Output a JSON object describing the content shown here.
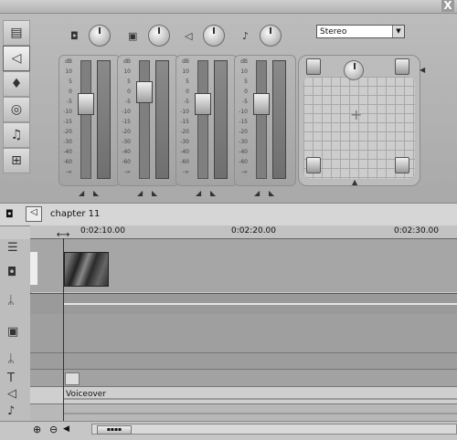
{
  "window": {
    "close_label": "X"
  },
  "mixer": {
    "tools": [
      {
        "icon": "video-toolbox-icon"
      },
      {
        "icon": "audio-toolbox-icon"
      },
      {
        "icon": "voiceover-icon"
      },
      {
        "icon": "disc-icon"
      },
      {
        "icon": "music-note-icon"
      },
      {
        "icon": "plug-icon"
      }
    ],
    "channels": [
      {
        "icon": "video-camera-icon"
      },
      {
        "icon": "clip-icon"
      },
      {
        "icon": "speaker-icon"
      },
      {
        "icon": "music-icon"
      }
    ],
    "output_mode": "Stereo",
    "db_scale": [
      "dB",
      "10",
      "5",
      "0",
      "-5",
      "-10",
      "-15",
      "-20",
      "-30",
      "-40",
      "-60",
      "-∞"
    ],
    "fader_levels": [
      0.34,
      0.22,
      0.34,
      0.34
    ]
  },
  "timeline": {
    "chapter": "chapter 11",
    "ruler_ticks": [
      "0:02:10.00",
      "0:02:20.00",
      "0:02:30.00"
    ],
    "voiceover_label": "Voiceover"
  }
}
